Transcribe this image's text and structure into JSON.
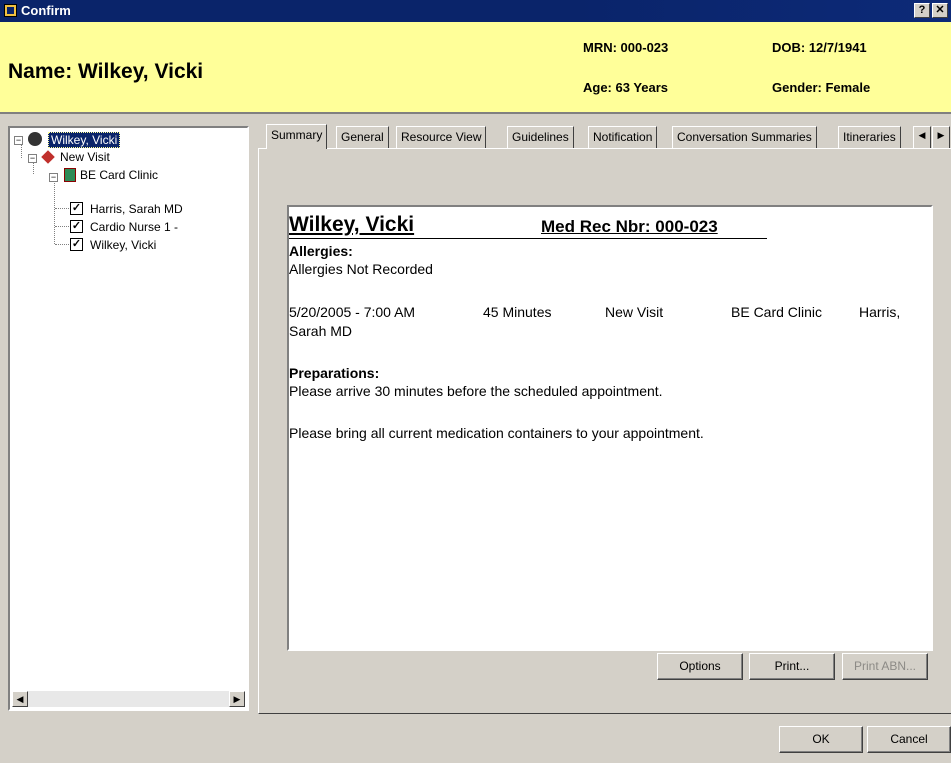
{
  "window": {
    "title": "Confirm",
    "help_btn": "?",
    "close_btn": "✕"
  },
  "banner": {
    "name": "Name: Wilkey, Vicki",
    "mrn": "MRN: 000-023",
    "age": "Age:  63 Years",
    "dob": "DOB: 12/7/1941",
    "gender": "Gender: Female"
  },
  "tree": {
    "root": "Wilkey, Vicki",
    "visit": "New Visit",
    "clinic": "BE Card Clinic",
    "resources": [
      "Harris, Sarah MD",
      "Cardio Nurse 1 -",
      "Wilkey, Vicki"
    ],
    "expand_glyph": "−",
    "check_glyph": "✓",
    "scroll_left": "◀",
    "scroll_right": "▶"
  },
  "tabs": [
    "Summary",
    "General",
    "Resource View",
    "Guidelines",
    "Notification",
    "Conversation Summaries",
    "Itineraries"
  ],
  "tab_scroll": {
    "left": "◀",
    "right": "▶"
  },
  "summary": {
    "patient": "Wilkey, Vicki",
    "med_rec": "Med Rec Nbr: 000-023",
    "allergies_label": "Allergies:",
    "allergies_value": "Allergies Not Recorded",
    "appt_date": "5/20/2005 - 7:00 AM",
    "appt_duration": "45 Minutes",
    "appt_type": "New Visit",
    "appt_location": "BE Card Clinic",
    "appt_provider": "Harris,",
    "appt_provider_cont": "Sarah MD",
    "prep_label": "Preparations:",
    "prep_1": "Please arrive 30 minutes before the scheduled appointment.",
    "prep_2": "Please bring all current medication containers to your appointment."
  },
  "buttons": {
    "options": "Options",
    "print": "Print...",
    "print_abn": "Print ABN...",
    "ok": "OK",
    "cancel": "Cancel"
  }
}
